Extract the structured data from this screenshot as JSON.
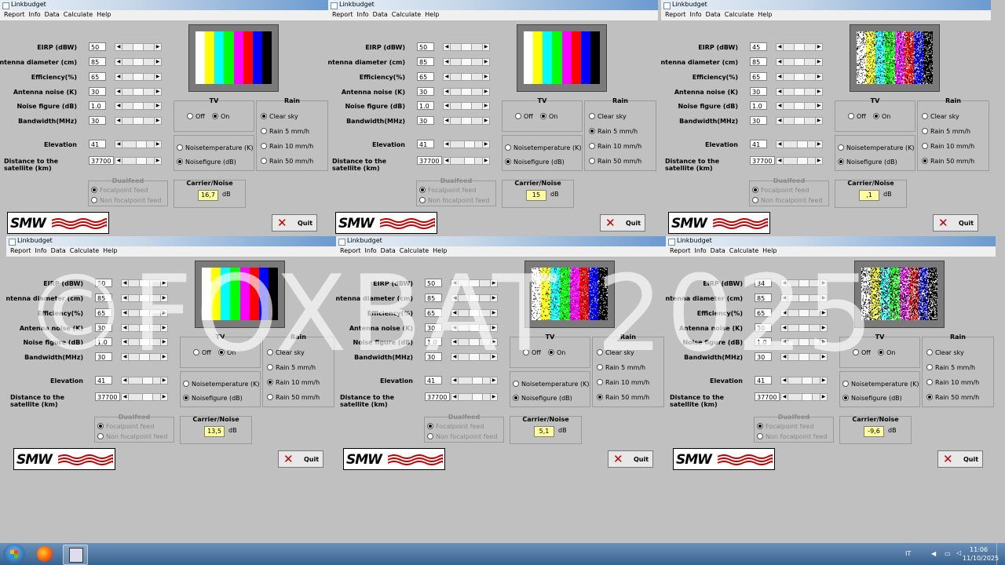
{
  "title": "Linkbudget",
  "menu": [
    "Report",
    "Info",
    "Data",
    "Calculate",
    "Help"
  ],
  "labels": {
    "eirp": "EIRP (dBW)",
    "antenna_diameter": "Antenna diameter (cm)",
    "efficiency": "Efficiency(%)",
    "antenna_noise": "Antenna noise (K)",
    "noise_figure": "Noise figure (dB)",
    "bandwidth": "Bandwidth(MHz)",
    "elevation": "Elevation",
    "distance": "Distance to the satellite (km)",
    "tv": "TV",
    "tv_off": "Off",
    "tv_on": "On",
    "rain": "Rain",
    "rain_options": [
      "Clear sky",
      "Rain 5 mm/h",
      "Rain 10 mm/h",
      "Rain 50 mm/h"
    ],
    "noisetemperature": "Noisetemperature (K)",
    "noisefigure_opt": "Noisefigure (dB)",
    "dualfeed": "Dualfeed",
    "focalpoint": "Focalpoint feed",
    "nonfocal": "Non focalpoint feed",
    "cn": "Carrier/Noise",
    "db": "dB",
    "quit": "Quit",
    "logo": "SMW"
  },
  "windows": [
    {
      "eirp": "50",
      "antenna": "85",
      "efficiency": "65",
      "antenna_noise": "30",
      "noise_figure": "1.0",
      "bandwidth": "30",
      "elevation": "41",
      "distance": "37700",
      "rain_selected": 0,
      "cn": "16,7",
      "noise_level": 0.0
    },
    {
      "eirp": "50",
      "antenna": "85",
      "efficiency": "65",
      "antenna_noise": "30",
      "noise_figure": "1.0",
      "bandwidth": "30",
      "elevation": "41",
      "distance": "37700",
      "rain_selected": 1,
      "cn": "15",
      "noise_level": 0.0
    },
    {
      "eirp": "45",
      "antenna": "85",
      "efficiency": "65",
      "antenna_noise": "30",
      "noise_figure": "1.0",
      "bandwidth": "30",
      "elevation": "41",
      "distance": "37700",
      "rain_selected": 3,
      "cn": ",1",
      "noise_level": 0.5
    },
    {
      "eirp": "50",
      "antenna": "85",
      "efficiency": "65",
      "antenna_noise": "30",
      "noise_figure": "1.0",
      "bandwidth": "30",
      "elevation": "41",
      "distance": "37700",
      "rain_selected": 2,
      "cn": "13,5",
      "noise_level": 0.0
    },
    {
      "eirp": "50",
      "antenna": "85",
      "efficiency": "65",
      "antenna_noise": "30",
      "noise_figure": "1.0",
      "bandwidth": "30",
      "elevation": "41",
      "distance": "37700",
      "rain_selected": 3,
      "cn": "5,1",
      "noise_level": 0.25
    },
    {
      "eirp": "34",
      "antenna": "85",
      "efficiency": "65",
      "antenna_noise": "30",
      "noise_figure": "1.0",
      "bandwidth": "30",
      "elevation": "41",
      "distance": "37700",
      "rain_selected": 3,
      "cn": "-9,6",
      "noise_level": 0.85
    }
  ],
  "testcard_colors": [
    "#ffffff",
    "#ffff00",
    "#00ffff",
    "#00ff00",
    "#ff00ff",
    "#ff0000",
    "#0000ff",
    "#000000"
  ],
  "watermark": "©FOXBAT 2025",
  "taskbar": {
    "lang": "IT",
    "time": "11:06",
    "date": "11/10/2025"
  }
}
